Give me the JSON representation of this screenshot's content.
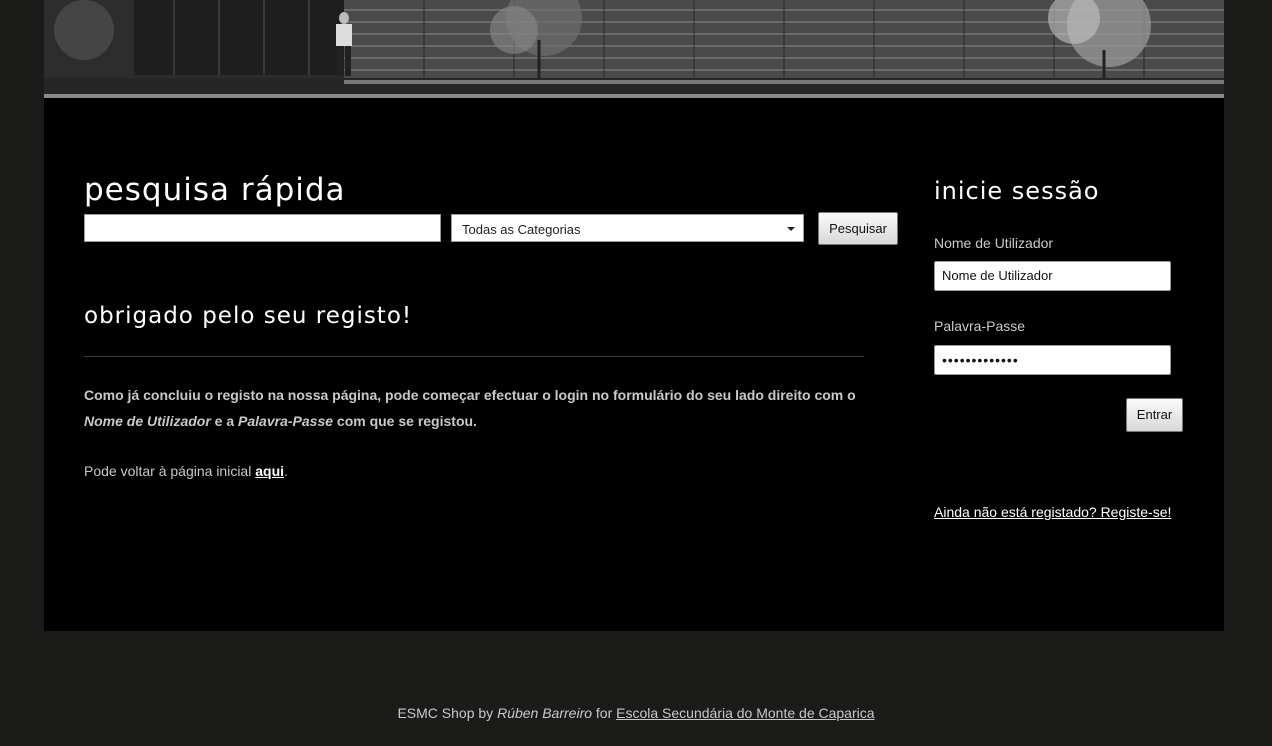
{
  "banner": {
    "image_name": "school-building-photo"
  },
  "search": {
    "title": "pesquisa rápida",
    "query_value": "",
    "category_selected": "Todas as Categorias",
    "button_label": "Pesquisar"
  },
  "content": {
    "title": "obrigado pelo seu registo!",
    "message_part1": "Como já concluiu o registo na nossa página, pode começar efectuar o login no formulário do seu lado direito com o ",
    "message_em1": "Nome de Utilizador",
    "message_part2": " e a ",
    "message_em2": "Palavra-Passe",
    "message_part3": " com que se registou.",
    "back_text": "Pode voltar à página inicial ",
    "back_link": "aqui",
    "back_end": "."
  },
  "login": {
    "title": "inicie sessão",
    "username_label": "Nome de Utilizador",
    "username_value": "Nome de Utilizador",
    "password_label": "Palavra-Passe",
    "password_value": "•••••••••••••",
    "submit_label": "Entrar",
    "register_link": "Ainda não está registado? Registe-se!"
  },
  "footer": {
    "prefix": "ESMC Shop by ",
    "author": "Rúben Barreiro",
    "mid": " for ",
    "school_link": "Escola Secundária do Monte de Caparica"
  }
}
